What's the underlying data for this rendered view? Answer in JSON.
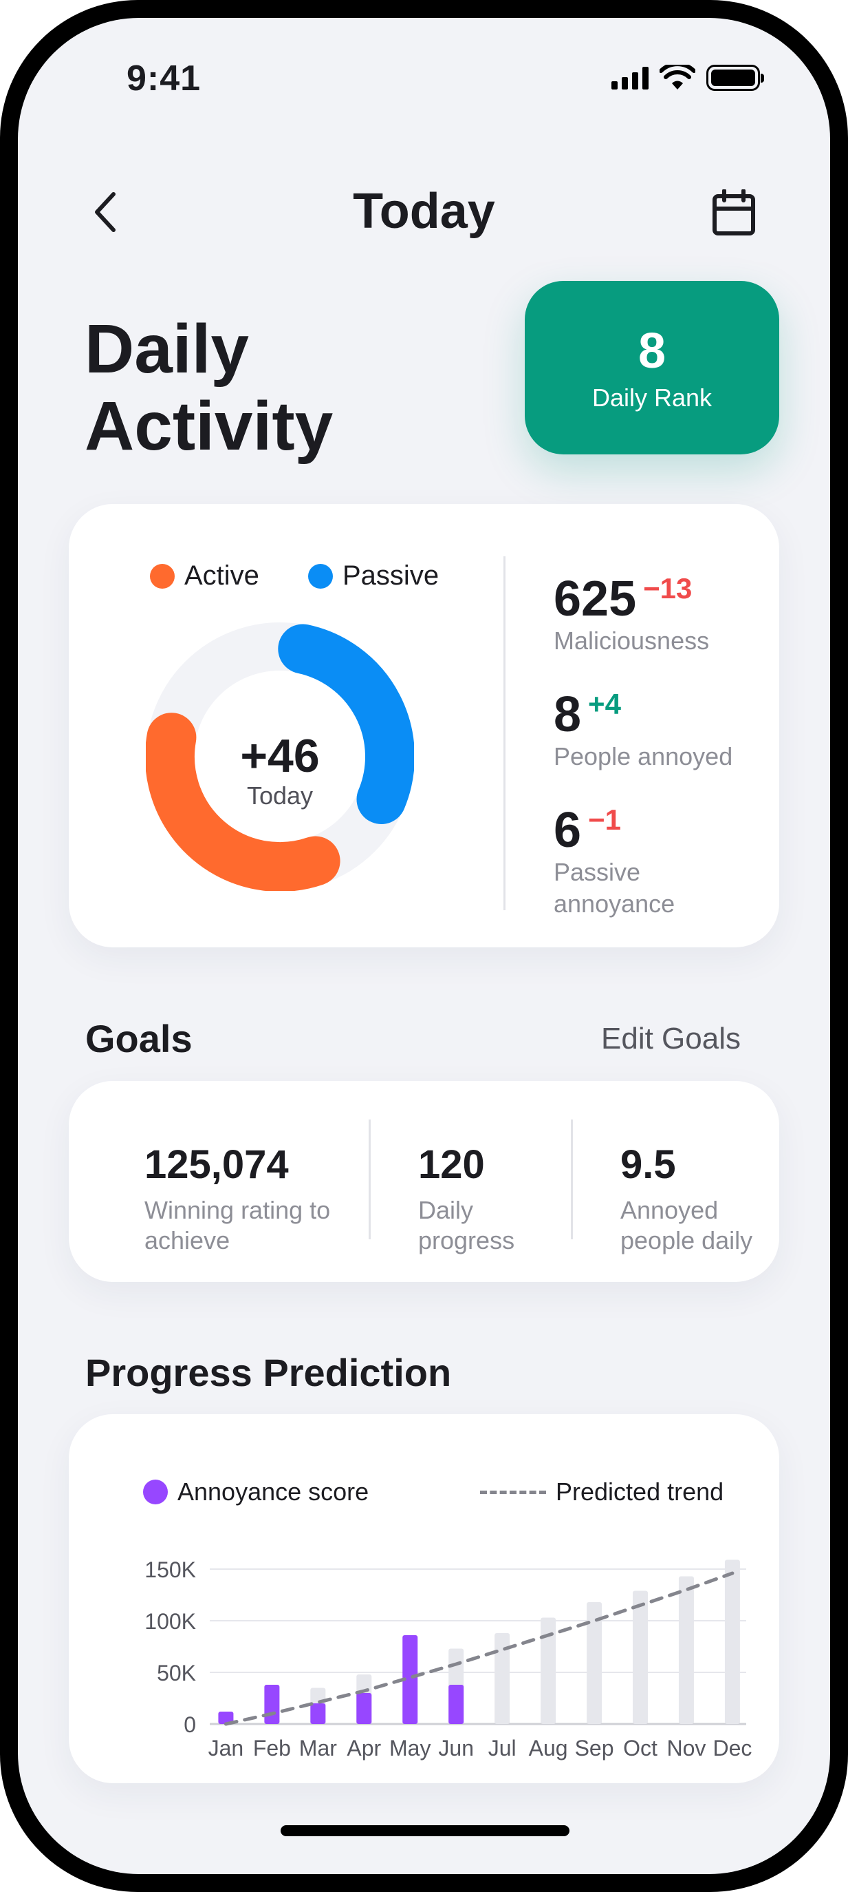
{
  "status_bar": {
    "time": "9:41"
  },
  "header": {
    "title": "Today"
  },
  "daily": {
    "title": "Daily Activity",
    "rank_value": "8",
    "rank_label": "Daily Rank"
  },
  "activity": {
    "legend": [
      {
        "label": "Active",
        "color": "#ff6a2e"
      },
      {
        "label": "Passive",
        "color": "#0a8df5"
      }
    ],
    "donut": {
      "value": "+46",
      "label": "Today",
      "active_fraction": 0.33,
      "passive_fraction": 0.28
    },
    "stats": [
      {
        "value": "625",
        "change": "−13",
        "label": "Maliciousness",
        "trend": "negative"
      },
      {
        "value": "8",
        "change": "+4",
        "label": "People annoyed",
        "trend": "positive"
      },
      {
        "value": "6",
        "change": "−1",
        "label": "Passive annoyance",
        "trend": "negative"
      }
    ]
  },
  "goals": {
    "title": "Goals",
    "edit_label": "Edit Goals",
    "items": [
      {
        "value": "125,074",
        "label": "Winning rating to achieve"
      },
      {
        "value": "120",
        "label": "Daily progress"
      },
      {
        "value": "9.5",
        "label": "Annoyed people daily"
      }
    ]
  },
  "prediction": {
    "title": "Progress Prediction"
  },
  "chart_data": {
    "type": "bar",
    "categories": [
      "Jan",
      "Feb",
      "Mar",
      "Apr",
      "May",
      "Jun",
      "Jul",
      "Aug",
      "Sep",
      "Oct",
      "Nov",
      "Dec"
    ],
    "series": [
      {
        "name": "Annoyance score",
        "color": "#9747ff",
        "values": [
          12,
          38,
          20,
          30,
          86,
          38,
          null,
          null,
          null,
          null,
          null,
          null
        ]
      },
      {
        "name": "Predicted trend",
        "color": "#84858d",
        "style": "dashed-line",
        "values": [
          0,
          10,
          21,
          32,
          45,
          58,
          72,
          86,
          100,
          115,
          130,
          146
        ]
      }
    ],
    "prediction_bars": {
      "color": "#e6e7ec",
      "values": [
        null,
        null,
        35,
        48,
        null,
        73,
        88,
        103,
        118,
        129,
        143,
        159
      ]
    },
    "y_ticks": [
      "0",
      "50K",
      "100K",
      "150K"
    ],
    "ylim": [
      0,
      150
    ],
    "grid": true,
    "legend_position": "top"
  }
}
